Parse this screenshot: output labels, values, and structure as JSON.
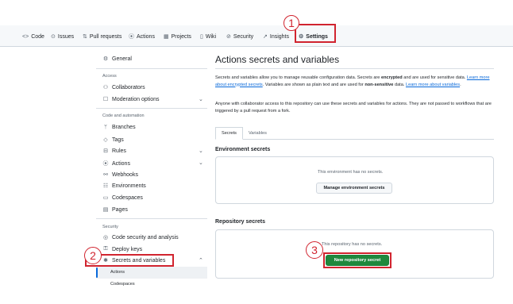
{
  "topnav": {
    "tabs": [
      {
        "icon": "code-icon",
        "glyph": "<>",
        "label": "Code"
      },
      {
        "icon": "issues-icon",
        "glyph": "⊙",
        "label": "Issues"
      },
      {
        "icon": "pull-request-icon",
        "glyph": "⇅",
        "label": "Pull requests"
      },
      {
        "icon": "actions-icon",
        "glyph": "⦿",
        "label": "Actions"
      },
      {
        "icon": "projects-icon",
        "glyph": "▦",
        "label": "Projects"
      },
      {
        "icon": "wiki-icon",
        "glyph": "▯",
        "label": "Wiki"
      },
      {
        "icon": "security-icon",
        "glyph": "⊘",
        "label": "Security"
      },
      {
        "icon": "insights-icon",
        "glyph": "↗",
        "label": "Insights"
      },
      {
        "icon": "gear-icon",
        "glyph": "⚙",
        "label": "Settings"
      }
    ]
  },
  "annotations": {
    "step1": "1",
    "step2": "2",
    "step3": "3"
  },
  "sidebar": {
    "general": "General",
    "access_heading": "Access",
    "collaborators": "Collaborators",
    "moderation": "Moderation options",
    "code_heading": "Code and automation",
    "branches": "Branches",
    "tags": "Tags",
    "rules": "Rules",
    "actions": "Actions",
    "webhooks": "Webhooks",
    "environments": "Environments",
    "codespaces": "Codespaces",
    "pages": "Pages",
    "security_heading": "Security",
    "code_security": "Code security and analysis",
    "deploy_keys": "Deploy keys",
    "secrets_vars": "Secrets and variables",
    "sub_actions": "Actions",
    "sub_codespaces": "Codespaces"
  },
  "main": {
    "title": "Actions secrets and variables",
    "p1_a": "Secrets and variables allow you to manage reusable configuration data. Secrets are ",
    "p1_b": "encrypted",
    "p1_c": " and are used for sensitive data. ",
    "p1_link1": "Learn more about encrypted secrets",
    "p1_d": ". Variables are shown as plain text and are used for ",
    "p1_e": "non-sensitive",
    "p1_f": " data. ",
    "p1_link2": "Learn more about variables",
    "p1_g": ".",
    "p2": "Anyone with collaborator access to this repository can use these secrets and variables for actions. They are not passed to workflows that are triggered by a pull request from a fork.",
    "tab_secrets": "Secrets",
    "tab_variables": "Variables",
    "env_heading": "Environment secrets",
    "env_empty": "This environment has no secrets.",
    "env_button": "Manage environment secrets",
    "repo_heading": "Repository secrets",
    "repo_empty": "This repository has no secrets.",
    "repo_button": "New repository secret"
  },
  "colors": {
    "accent": "#0969da",
    "primary_button": "#1f883d",
    "annotation": "#d1242f"
  }
}
